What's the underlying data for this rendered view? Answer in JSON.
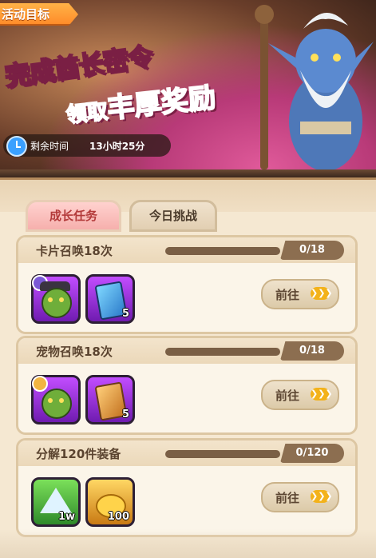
{
  "banner": {
    "event_tag": "活动目标",
    "title_line1_a": "完成",
    "title_line1_b": "酋长密令",
    "title_line2_a": "领取",
    "title_line2_b": "丰厚奖励",
    "timer_label": "剩余时间",
    "timer_value": "13小时25分"
  },
  "tabs": [
    {
      "label": "成长任务",
      "active": true
    },
    {
      "label": "今日挑战",
      "active": false
    }
  ],
  "tasks": [
    {
      "title": "卡片召唤18次",
      "progress": "0/18",
      "progress_fraction": 0,
      "rewards": [
        {
          "icon": "goblin-portrait-icon",
          "qty": ""
        },
        {
          "icon": "summon-card-icon",
          "qty": "5"
        }
      ],
      "button": "前往",
      "button_arrows": "❯❯❯"
    },
    {
      "title": "宠物召唤18次",
      "progress": "0/18",
      "progress_fraction": 0,
      "rewards": [
        {
          "icon": "goblin-portrait-icon",
          "qty": ""
        },
        {
          "icon": "pet-card-icon",
          "qty": "5"
        }
      ],
      "button": "前往",
      "button_arrows": "❯❯❯"
    },
    {
      "title": "分解120件装备",
      "progress": "0/120",
      "progress_fraction": 0,
      "rewards": [
        {
          "icon": "mountain-stone-icon",
          "qty": "1w"
        },
        {
          "icon": "gold-coins-icon",
          "qty": "100"
        }
      ],
      "button": "前往",
      "button_arrows": "❯❯❯"
    }
  ],
  "colors": {
    "accent": "#f3b21a",
    "tab_active_text": "#b33a3a",
    "title_yellow": "#ffe83a",
    "title_pink": "#ff4f9a"
  }
}
